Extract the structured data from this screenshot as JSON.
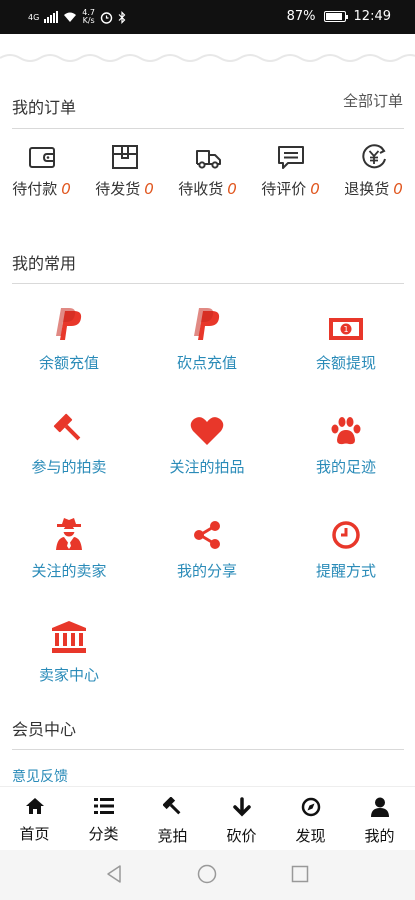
{
  "status_bar": {
    "network": "4G",
    "speed_value": "4.7",
    "speed_unit": "K/s",
    "battery": "87%",
    "time": "12:49"
  },
  "orders": {
    "title": "我的订单",
    "all_label": "全部订单",
    "items": [
      {
        "label": "待付款",
        "count": "0",
        "icon": "wallet-icon"
      },
      {
        "label": "待发货",
        "count": "0",
        "icon": "package-icon"
      },
      {
        "label": "待收货",
        "count": "0",
        "icon": "truck-icon"
      },
      {
        "label": "待评价",
        "count": "0",
        "icon": "comment-icon"
      },
      {
        "label": "退换货",
        "count": "0",
        "icon": "yen-refund-icon"
      }
    ]
  },
  "common": {
    "title": "我的常用",
    "items": [
      {
        "label": "余额充值",
        "icon": "paypal-icon"
      },
      {
        "label": "砍点充值",
        "icon": "paypal-icon"
      },
      {
        "label": "余额提现",
        "icon": "money-bill-icon"
      },
      {
        "label": "参与的拍卖",
        "icon": "gavel-icon"
      },
      {
        "label": "关注的拍品",
        "icon": "heart-icon"
      },
      {
        "label": "我的足迹",
        "icon": "paw-icon"
      },
      {
        "label": "关注的卖家",
        "icon": "user-secret-icon"
      },
      {
        "label": "我的分享",
        "icon": "share-icon"
      },
      {
        "label": "提醒方式",
        "icon": "clock-icon"
      },
      {
        "label": "卖家中心",
        "icon": "bank-icon"
      }
    ],
    "accent_color": "#e8372a",
    "label_color": "#2a8bb8"
  },
  "member": {
    "title": "会员中心",
    "feedback": "意见反馈"
  },
  "tabbar": {
    "items": [
      {
        "label": "首页",
        "icon": "home-icon"
      },
      {
        "label": "分类",
        "icon": "list-icon"
      },
      {
        "label": "竞拍",
        "icon": "gavel-icon"
      },
      {
        "label": "砍价",
        "icon": "arrow-down-icon"
      },
      {
        "label": "发现",
        "icon": "compass-icon"
      },
      {
        "label": "我的",
        "icon": "user-icon"
      }
    ]
  }
}
